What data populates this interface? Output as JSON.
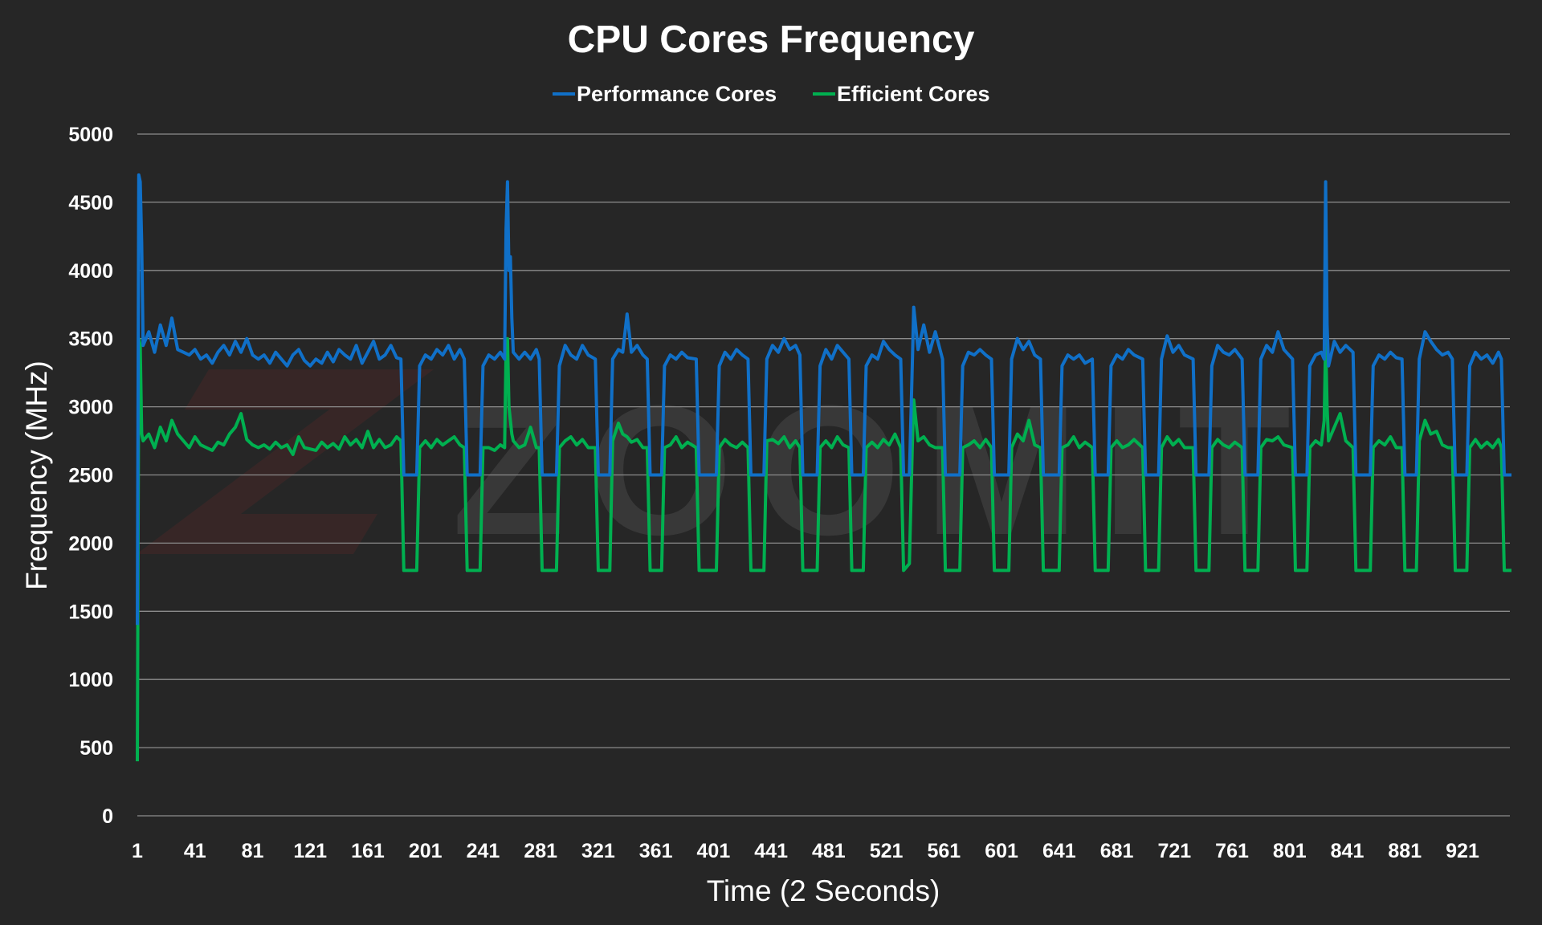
{
  "chart_data": {
    "type": "line",
    "title": "CPU Cores Frequency",
    "xlabel": "Time (2 Seconds)",
    "ylabel": "Frequency (MHz)",
    "ylim": [
      0,
      5000
    ],
    "xlim": [
      1,
      955
    ],
    "grid": "horizontal",
    "legend_position": "top",
    "yticks": [
      "0",
      "500",
      "1000",
      "1500",
      "2000",
      "2500",
      "3000",
      "3500",
      "4000",
      "4500",
      "5000"
    ],
    "xticks": [
      "1",
      "41",
      "81",
      "121",
      "161",
      "201",
      "241",
      "281",
      "321",
      "361",
      "401",
      "441",
      "481",
      "521",
      "561",
      "601",
      "641",
      "681",
      "721",
      "761",
      "801",
      "841",
      "881",
      "921"
    ],
    "series": [
      {
        "name": "Performance Cores",
        "color": "#1070C8"
      },
      {
        "name": "Efficient Cores",
        "color": "#00B050"
      }
    ],
    "columns": [
      "Time",
      "Performance Cores",
      "Efficient Cores"
    ],
    "rows": [
      [
        1,
        1400,
        400
      ],
      [
        2,
        4700,
        3500
      ],
      [
        3,
        4650,
        3450
      ],
      [
        4,
        4200,
        2800
      ],
      [
        5,
        3450,
        2750
      ],
      [
        9,
        3550,
        2800
      ],
      [
        13,
        3400,
        2700
      ],
      [
        17,
        3600,
        2850
      ],
      [
        21,
        3450,
        2750
      ],
      [
        25,
        3650,
        2900
      ],
      [
        29,
        3420,
        2800
      ],
      [
        33,
        3400,
        2750
      ],
      [
        37,
        3380,
        2700
      ],
      [
        41,
        3420,
        2780
      ],
      [
        45,
        3350,
        2720
      ],
      [
        49,
        3380,
        2700
      ],
      [
        53,
        3320,
        2680
      ],
      [
        57,
        3400,
        2740
      ],
      [
        61,
        3450,
        2720
      ],
      [
        65,
        3380,
        2800
      ],
      [
        69,
        3480,
        2850
      ],
      [
        73,
        3400,
        2950
      ],
      [
        77,
        3500,
        2760
      ],
      [
        81,
        3380,
        2720
      ],
      [
        85,
        3350,
        2700
      ],
      [
        89,
        3380,
        2720
      ],
      [
        93,
        3320,
        2690
      ],
      [
        97,
        3400,
        2740
      ],
      [
        101,
        3350,
        2700
      ],
      [
        105,
        3300,
        2720
      ],
      [
        109,
        3380,
        2650
      ],
      [
        113,
        3420,
        2780
      ],
      [
        117,
        3340,
        2700
      ],
      [
        121,
        3300,
        2690
      ],
      [
        125,
        3350,
        2680
      ],
      [
        129,
        3320,
        2740
      ],
      [
        133,
        3400,
        2700
      ],
      [
        137,
        3330,
        2730
      ],
      [
        141,
        3420,
        2690
      ],
      [
        145,
        3380,
        2780
      ],
      [
        149,
        3350,
        2720
      ],
      [
        153,
        3450,
        2760
      ],
      [
        157,
        3320,
        2700
      ],
      [
        161,
        3400,
        2820
      ],
      [
        165,
        3480,
        2700
      ],
      [
        169,
        3350,
        2760
      ],
      [
        173,
        3380,
        2700
      ],
      [
        177,
        3450,
        2720
      ],
      [
        181,
        3360,
        2780
      ],
      [
        184,
        3350,
        2750
      ],
      [
        186,
        2500,
        1800
      ],
      [
        195,
        2500,
        1800
      ],
      [
        197,
        3300,
        2700
      ],
      [
        201,
        3380,
        2750
      ],
      [
        205,
        3350,
        2700
      ],
      [
        209,
        3420,
        2760
      ],
      [
        213,
        3380,
        2720
      ],
      [
        217,
        3450,
        2750
      ],
      [
        221,
        3350,
        2780
      ],
      [
        225,
        3420,
        2720
      ],
      [
        228,
        3350,
        2700
      ],
      [
        230,
        2500,
        1800
      ],
      [
        239,
        2500,
        1800
      ],
      [
        241,
        3300,
        2700
      ],
      [
        245,
        3380,
        2700
      ],
      [
        249,
        3350,
        2680
      ],
      [
        253,
        3400,
        2720
      ],
      [
        256,
        3350,
        2700
      ],
      [
        257,
        4300,
        3400
      ],
      [
        258,
        4650,
        3500
      ],
      [
        259,
        4000,
        3000
      ],
      [
        260,
        4100,
        2900
      ],
      [
        261,
        3650,
        2800
      ],
      [
        262,
        3400,
        2750
      ],
      [
        266,
        3350,
        2700
      ],
      [
        270,
        3400,
        2720
      ],
      [
        274,
        3350,
        2850
      ],
      [
        278,
        3420,
        2700
      ],
      [
        280,
        3350,
        2700
      ],
      [
        282,
        2500,
        1800
      ],
      [
        292,
        2500,
        1800
      ],
      [
        294,
        3300,
        2700
      ],
      [
        298,
        3450,
        2750
      ],
      [
        302,
        3380,
        2780
      ],
      [
        306,
        3350,
        2720
      ],
      [
        310,
        3450,
        2760
      ],
      [
        314,
        3380,
        2700
      ],
      [
        319,
        3350,
        2700
      ],
      [
        321,
        2500,
        1800
      ],
      [
        329,
        2500,
        1800
      ],
      [
        331,
        3350,
        2750
      ],
      [
        335,
        3420,
        2880
      ],
      [
        338,
        3400,
        2800
      ],
      [
        341,
        3680,
        2780
      ],
      [
        344,
        3400,
        2740
      ],
      [
        348,
        3450,
        2760
      ],
      [
        352,
        3380,
        2700
      ],
      [
        355,
        3350,
        2700
      ],
      [
        357,
        2500,
        1800
      ],
      [
        365,
        2500,
        1800
      ],
      [
        367,
        3300,
        2700
      ],
      [
        371,
        3380,
        2720
      ],
      [
        375,
        3350,
        2780
      ],
      [
        379,
        3400,
        2700
      ],
      [
        383,
        3360,
        2740
      ],
      [
        389,
        3350,
        2700
      ],
      [
        391,
        2500,
        1800
      ],
      [
        403,
        2500,
        1800
      ],
      [
        405,
        3300,
        2700
      ],
      [
        409,
        3400,
        2760
      ],
      [
        413,
        3350,
        2720
      ],
      [
        417,
        3420,
        2700
      ],
      [
        421,
        3380,
        2740
      ],
      [
        425,
        3350,
        2700
      ],
      [
        427,
        2500,
        1800
      ],
      [
        436,
        2500,
        1800
      ],
      [
        438,
        3350,
        2750
      ],
      [
        442,
        3450,
        2760
      ],
      [
        446,
        3400,
        2730
      ],
      [
        450,
        3500,
        2780
      ],
      [
        454,
        3420,
        2700
      ],
      [
        458,
        3450,
        2750
      ],
      [
        461,
        3380,
        2700
      ],
      [
        463,
        2500,
        1800
      ],
      [
        473,
        2500,
        1800
      ],
      [
        475,
        3300,
        2700
      ],
      [
        479,
        3420,
        2750
      ],
      [
        483,
        3350,
        2700
      ],
      [
        487,
        3450,
        2780
      ],
      [
        491,
        3400,
        2720
      ],
      [
        495,
        3350,
        2700
      ],
      [
        497,
        2500,
        1800
      ],
      [
        505,
        2500,
        1800
      ],
      [
        507,
        3300,
        2700
      ],
      [
        511,
        3380,
        2740
      ],
      [
        515,
        3350,
        2700
      ],
      [
        519,
        3480,
        2760
      ],
      [
        523,
        3420,
        2720
      ],
      [
        527,
        3380,
        2800
      ],
      [
        531,
        3350,
        2700
      ],
      [
        533,
        2500,
        1800
      ],
      [
        537,
        2500,
        1850
      ],
      [
        539,
        3300,
        2700
      ],
      [
        540,
        3730,
        3050
      ],
      [
        543,
        3420,
        2750
      ],
      [
        547,
        3600,
        2780
      ],
      [
        551,
        3400,
        2720
      ],
      [
        555,
        3550,
        2700
      ],
      [
        560,
        3350,
        2700
      ],
      [
        562,
        2500,
        1800
      ],
      [
        572,
        2500,
        1800
      ],
      [
        574,
        3300,
        2700
      ],
      [
        578,
        3400,
        2720
      ],
      [
        582,
        3380,
        2750
      ],
      [
        586,
        3420,
        2700
      ],
      [
        590,
        3380,
        2760
      ],
      [
        594,
        3350,
        2700
      ],
      [
        596,
        2500,
        1800
      ],
      [
        606,
        2500,
        1800
      ],
      [
        608,
        3350,
        2700
      ],
      [
        612,
        3500,
        2800
      ],
      [
        616,
        3420,
        2750
      ],
      [
        620,
        3480,
        2900
      ],
      [
        624,
        3380,
        2720
      ],
      [
        628,
        3350,
        2700
      ],
      [
        630,
        2500,
        1800
      ],
      [
        641,
        2500,
        1800
      ],
      [
        643,
        3300,
        2700
      ],
      [
        647,
        3380,
        2720
      ],
      [
        651,
        3350,
        2780
      ],
      [
        655,
        3380,
        2700
      ],
      [
        659,
        3320,
        2740
      ],
      [
        664,
        3350,
        2700
      ],
      [
        666,
        2500,
        1800
      ],
      [
        675,
        2500,
        1800
      ],
      [
        677,
        3300,
        2700
      ],
      [
        681,
        3380,
        2750
      ],
      [
        685,
        3350,
        2700
      ],
      [
        689,
        3420,
        2720
      ],
      [
        693,
        3380,
        2760
      ],
      [
        699,
        3350,
        2700
      ],
      [
        701,
        2500,
        1800
      ],
      [
        710,
        2500,
        1800
      ],
      [
        712,
        3350,
        2700
      ],
      [
        716,
        3520,
        2780
      ],
      [
        720,
        3400,
        2720
      ],
      [
        724,
        3450,
        2760
      ],
      [
        728,
        3380,
        2700
      ],
      [
        734,
        3350,
        2700
      ],
      [
        736,
        2500,
        1800
      ],
      [
        745,
        2500,
        1800
      ],
      [
        747,
        3300,
        2700
      ],
      [
        751,
        3450,
        2760
      ],
      [
        755,
        3400,
        2720
      ],
      [
        759,
        3380,
        2700
      ],
      [
        763,
        3420,
        2740
      ],
      [
        768,
        3350,
        2700
      ],
      [
        770,
        2500,
        1800
      ],
      [
        779,
        2500,
        1800
      ],
      [
        781,
        3350,
        2700
      ],
      [
        785,
        3450,
        2760
      ],
      [
        789,
        3400,
        2750
      ],
      [
        793,
        3550,
        2780
      ],
      [
        797,
        3420,
        2720
      ],
      [
        803,
        3350,
        2700
      ],
      [
        805,
        2500,
        1800
      ],
      [
        813,
        2500,
        1800
      ],
      [
        815,
        3300,
        2700
      ],
      [
        819,
        3380,
        2750
      ],
      [
        823,
        3400,
        2720
      ],
      [
        825,
        3350,
        2900
      ],
      [
        826,
        4650,
        3500
      ],
      [
        827,
        3600,
        3000
      ],
      [
        828,
        3300,
        2750
      ],
      [
        832,
        3480,
        2850
      ],
      [
        836,
        3400,
        2950
      ],
      [
        840,
        3450,
        2750
      ],
      [
        845,
        3400,
        2700
      ],
      [
        847,
        2500,
        1800
      ],
      [
        857,
        2500,
        1800
      ],
      [
        859,
        3300,
        2700
      ],
      [
        863,
        3380,
        2750
      ],
      [
        867,
        3350,
        2720
      ],
      [
        871,
        3400,
        2780
      ],
      [
        875,
        3360,
        2700
      ],
      [
        879,
        3350,
        2700
      ],
      [
        881,
        2500,
        1800
      ],
      [
        889,
        2500,
        1800
      ],
      [
        891,
        3350,
        2750
      ],
      [
        895,
        3550,
        2900
      ],
      [
        899,
        3480,
        2800
      ],
      [
        903,
        3420,
        2820
      ],
      [
        907,
        3380,
        2720
      ],
      [
        911,
        3400,
        2700
      ],
      [
        914,
        3350,
        2700
      ],
      [
        916,
        2500,
        1800
      ],
      [
        924,
        2500,
        1800
      ],
      [
        926,
        3300,
        2700
      ],
      [
        930,
        3400,
        2760
      ],
      [
        934,
        3350,
        2700
      ],
      [
        938,
        3380,
        2740
      ],
      [
        942,
        3320,
        2700
      ],
      [
        946,
        3400,
        2760
      ],
      [
        948,
        3350,
        2700
      ],
      [
        950,
        2500,
        1800
      ],
      [
        955,
        2500,
        1800
      ]
    ]
  },
  "watermark": "ZOOMIT"
}
